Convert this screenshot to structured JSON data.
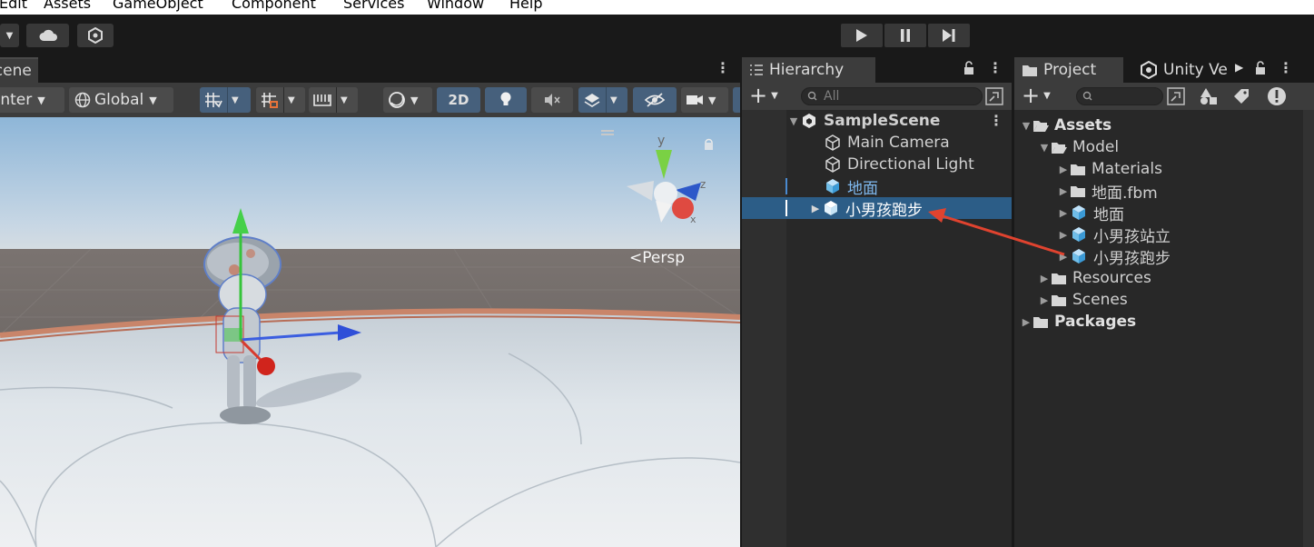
{
  "menu": [
    "Edit",
    "Assets",
    "GameObject",
    "Component",
    "Services",
    "Window",
    "Help"
  ],
  "scene": {
    "tab_label": "Scene",
    "pivot_label": "Center",
    "space_label": "Global",
    "mode_2d_label": "2D",
    "projection_label": "Persp",
    "gizmo_axes": {
      "y": "y",
      "z": "z",
      "x": "x"
    }
  },
  "hierarchy": {
    "tab_label": "Hierarchy",
    "search_placeholder": "All",
    "scene_name": "SampleScene",
    "items": [
      {
        "label": "Main Camera"
      },
      {
        "label": "Directional Light"
      },
      {
        "label": "地面"
      },
      {
        "label": "小男孩跑步",
        "selected": true
      }
    ]
  },
  "project": {
    "tab_label": "Project",
    "tab2_label": "Unity Ve",
    "tree": {
      "assets": "Assets",
      "model": "Model",
      "materials": "Materials",
      "ground_fbm": "地面.fbm",
      "ground": "地面",
      "boy_stand": "小男孩站立",
      "boy_run": "小男孩跑步",
      "resources": "Resources",
      "scenes": "Scenes",
      "packages": "Packages"
    }
  },
  "colors": {
    "selection": "#2c5d87",
    "annotation_arrow": "#e0432f",
    "accent_blue": "#46607c"
  }
}
